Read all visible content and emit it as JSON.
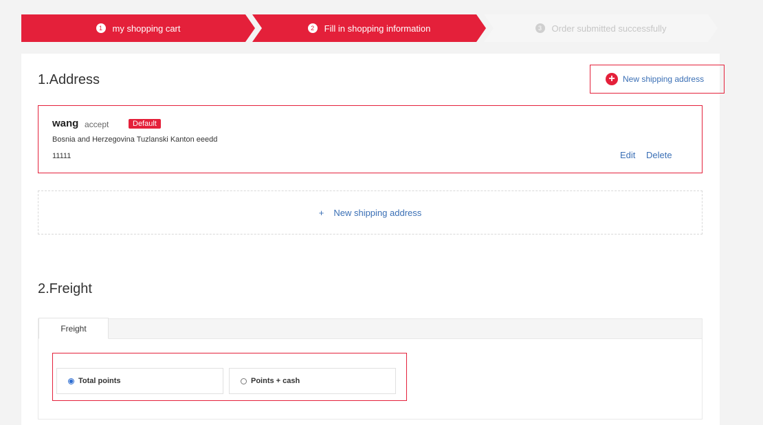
{
  "steps": [
    {
      "num": "1",
      "label": "my shopping cart",
      "state": "done"
    },
    {
      "num": "2",
      "label": "Fill in shopping information",
      "state": "active"
    },
    {
      "num": "3",
      "label": "Order submitted successfully",
      "state": "inactive"
    }
  ],
  "address_section": {
    "title": "1.Address",
    "new_address_button": "New shipping address",
    "address": {
      "name": "wang",
      "tag": "accept",
      "default_badge": "Default",
      "line": "Bosnia and Herzegovina Tuzlanski Kanton eeedd",
      "zip": "11111",
      "edit": "Edit",
      "delete": "Delete"
    },
    "add_box": {
      "plus": "+",
      "label": "New shipping address"
    }
  },
  "freight_section": {
    "title": "2.Freight",
    "tab": "Freight",
    "options": [
      {
        "label": "Total points",
        "selected": true
      },
      {
        "label": "Points + cash",
        "selected": false
      }
    ]
  },
  "colors": {
    "accent": "#e4203a",
    "link": "#3a6fb5",
    "radio": "#2f6ed1"
  }
}
